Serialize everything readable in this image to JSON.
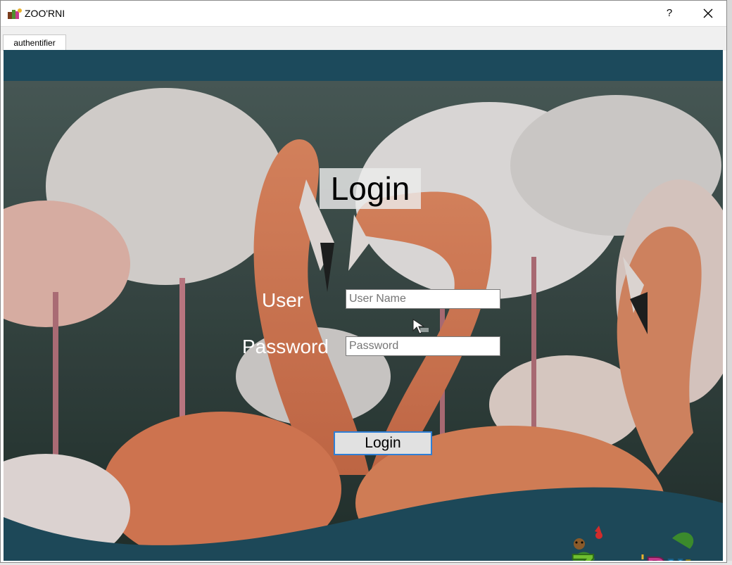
{
  "window": {
    "title": "ZOO'RNI",
    "help_label": "?",
    "close_label": "✕"
  },
  "tabs": [
    {
      "label": "authentifier",
      "active": true
    }
  ],
  "login": {
    "title": "Login",
    "user_label": "User",
    "password_label": "Password",
    "user_placeholder": "User Name",
    "password_placeholder": "Password",
    "button_label": "Login"
  },
  "colors": {
    "header_band": "#1c4a5c",
    "accent_focus": "#2f7fd6"
  },
  "icons": {
    "app": "zoo-app-icon",
    "cursor": "mouse-pointer-icon",
    "logo": "zoorni-logo"
  }
}
